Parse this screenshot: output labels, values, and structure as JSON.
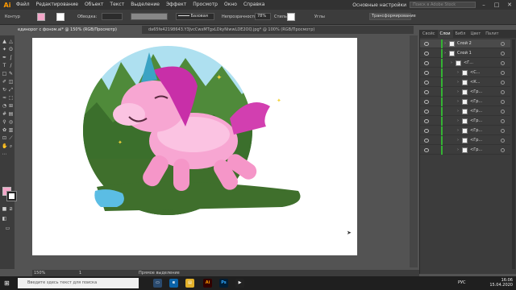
{
  "menubar": {
    "logo": "Ai",
    "items": [
      "Файл",
      "Редактирование",
      "Объект",
      "Текст",
      "Выделение",
      "Эффект",
      "Просмотр",
      "Окно",
      "Справка"
    ],
    "workspace": "Основные настройки",
    "search_placeholder": "Поиск в Adobe Stock"
  },
  "controlbar": {
    "label": "Контур",
    "stroke_label": "Обводка:",
    "brush_label": "Базовая",
    "opacity_label": "Непрозрачность:",
    "opacity_value": "78%",
    "style_label": "Стиль:",
    "angles_label": "Углы",
    "transform_label": "Трансформирование"
  },
  "tabs": [
    {
      "label": "единорог с фоном.ai* @ 150% (RGB/Просмотр)",
      "active": true
    },
    {
      "label": "da65fe42198643.Y3JvcCwxMTgxLDkyNiwwLDE2OQ.jpg* @ 100% (RGB/Просмотр)",
      "active": false
    }
  ],
  "panel": {
    "tabs": [
      "Свойс",
      "Слои",
      "Библ",
      "Цвет",
      "Палит"
    ],
    "active_tab": "Слои",
    "layers": [
      {
        "name": "Слой 2",
        "indent": 0,
        "selected": true
      },
      {
        "name": "Слой 1",
        "indent": 0,
        "selected": false
      },
      {
        "name": "<Г...",
        "indent": 1,
        "selected": false
      },
      {
        "name": "<С...",
        "indent": 2,
        "selected": false
      },
      {
        "name": "<К...",
        "indent": 2,
        "selected": false
      },
      {
        "name": "<Гр...",
        "indent": 2,
        "selected": false
      },
      {
        "name": "<Гр...",
        "indent": 2,
        "selected": false
      },
      {
        "name": "<Гр...",
        "indent": 2,
        "selected": false
      },
      {
        "name": "<Гр...",
        "indent": 2,
        "selected": false
      },
      {
        "name": "<Гр...",
        "indent": 2,
        "selected": false
      },
      {
        "name": "<Гр...",
        "indent": 2,
        "selected": false
      },
      {
        "name": "<Гр...",
        "indent": 2,
        "selected": false
      }
    ]
  },
  "status": {
    "zoom": "150%",
    "page": "1",
    "mode": "Прямое выделение"
  },
  "taskbar": {
    "search_placeholder": "Введите здесь текст для поиска",
    "lang": "РУС",
    "time": "16:06",
    "date": "15.04.2020"
  },
  "colors": {
    "accent": "#ff9a00",
    "layer_green": "#34b233",
    "fill_swatch": "#f4a7c9"
  }
}
